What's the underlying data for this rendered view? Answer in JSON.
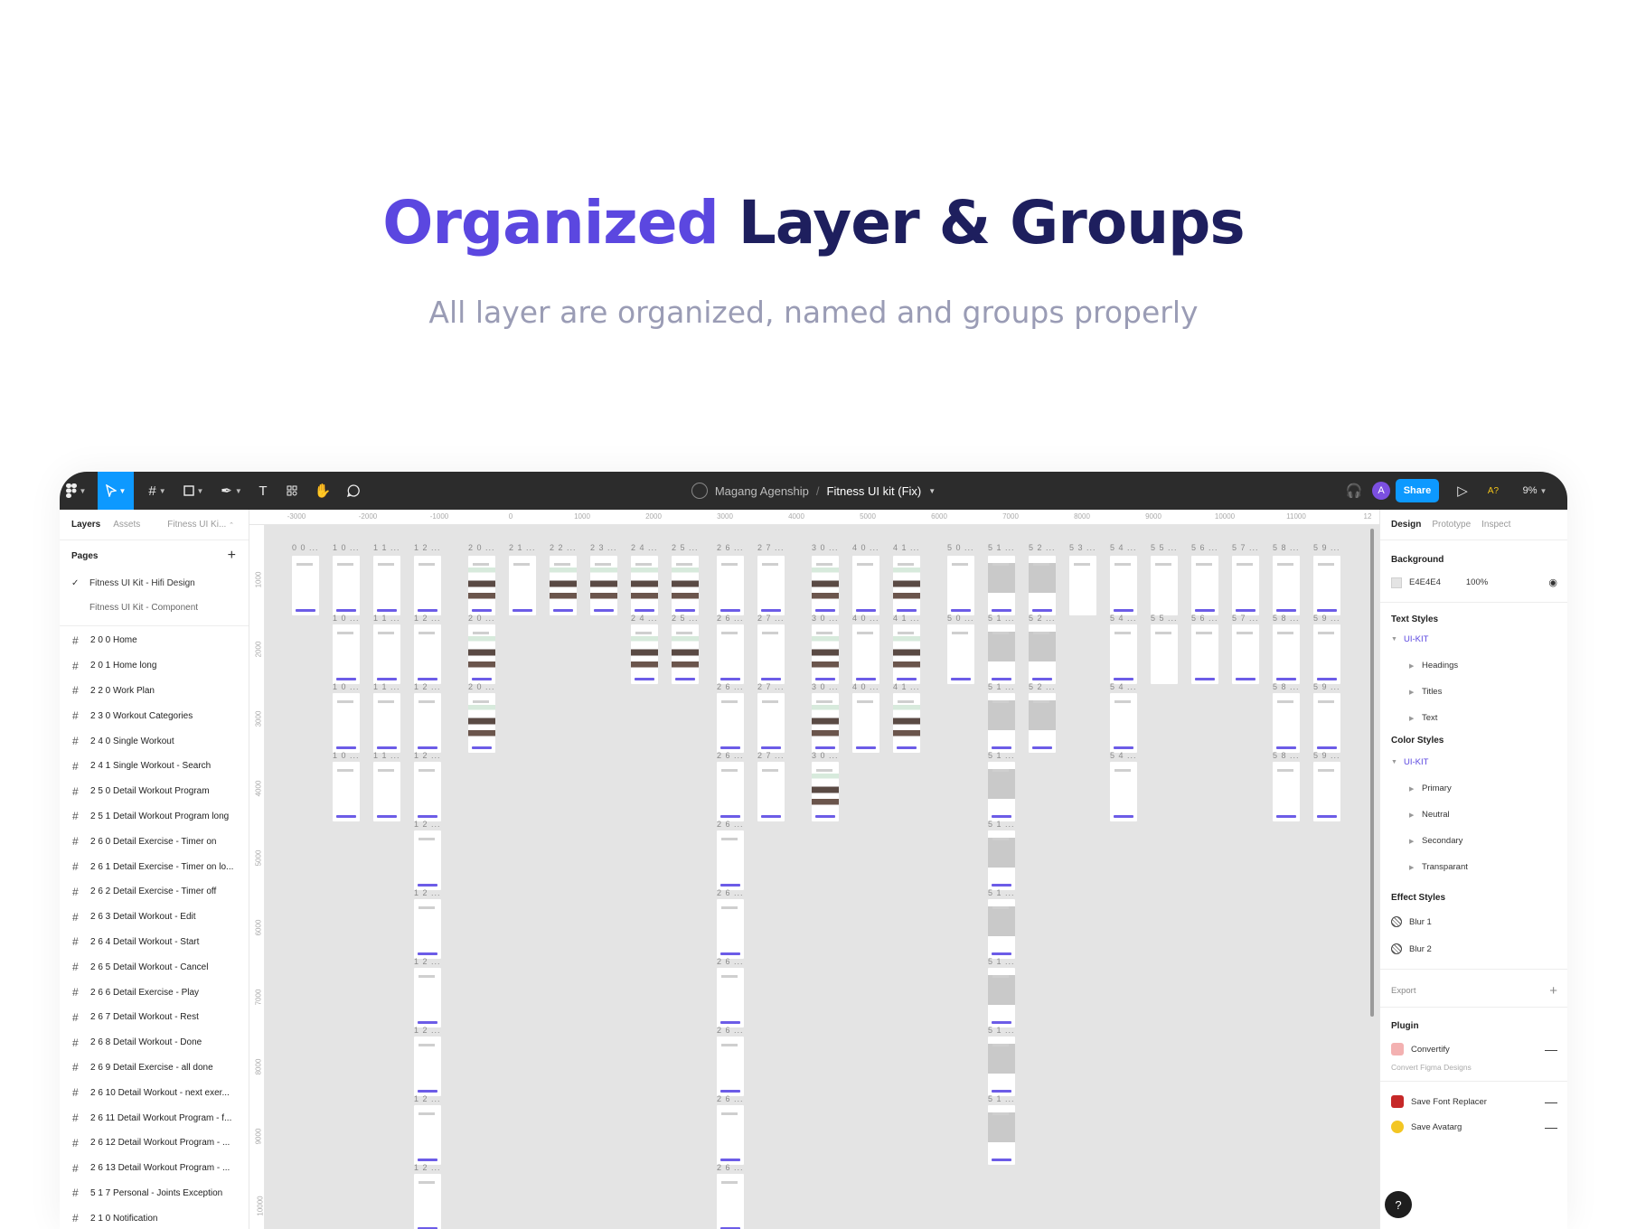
{
  "hero": {
    "title_accent": "Organized",
    "title_rest": "Layer & Groups",
    "subtitle": "All layer are organized, named and groups properly"
  },
  "colors": {
    "accent": "#5b47e0",
    "title": "#1e1f5e",
    "subtitle": "#9a9cb5",
    "toolbar": "#2c2c2c",
    "figma_blue": "#0d99ff",
    "canvas": "#e4e4e4"
  },
  "toolbar": {
    "icons": [
      "figma-menu-icon",
      "move-tool-icon",
      "frame-tool-icon",
      "shape-tool-icon",
      "pen-tool-icon",
      "text-tool-icon",
      "resources-icon",
      "hand-tool-icon",
      "comment-tool-icon"
    ],
    "team": "Magang Agenship",
    "separator": "/",
    "file": "Fitness UI kit (Fix)",
    "avatar_initial": "A",
    "share_label": "Share",
    "a11y_badge": "A?",
    "zoom": "9%"
  },
  "left_panel": {
    "tabs": [
      "Layers",
      "Assets"
    ],
    "page_selector": "Fitness UI Ki...",
    "pages_title": "Pages",
    "pages": [
      {
        "label": "Fitness UI Kit - Hifi Design",
        "checked": true
      },
      {
        "label": "Fitness UI Kit - Component",
        "checked": false
      }
    ],
    "layers": [
      "2 0 0  Home",
      "2 0 1  Home long",
      "2 2 0  Work Plan",
      "2 3 0  Workout Categories",
      "2 4 0 Single Workout",
      "2 4 1 Single Workout - Search",
      " 2 5 0  Detail Workout Program",
      " 2 5 1  Detail Workout Program long",
      "2 6 0  Detail Exercise - Timer on",
      "2 6 1  Detail Exercise - Timer on lo...",
      "2 6 2  Detail Exercise - Timer off",
      "2 6 3  Detail Workout - Edit",
      "2 6 4  Detail Workout - Start",
      "2 6 5  Detail Workout - Cancel",
      "2 6 6  Detail Exercise - Play",
      "2 6 7  Detail Workout - Rest",
      "2 6 8  Detail Workout - Done",
      "2 6 9  Detail Exercise - all done",
      "2 6 10  Detail Workout - next exer...",
      " 2 6 11  Detail Workout Program - f...",
      " 2 6 12  Detail Workout Program - ...",
      " 2 6 13  Detail Workout Program - ...",
      "5 1 7 Personal - Joints Exception",
      "2 1 0 Notification"
    ]
  },
  "rulers": {
    "top": [
      "-3000",
      "-2000",
      "-1000",
      "0",
      "1000",
      "2000",
      "3000",
      "4000",
      "5000",
      "6000",
      "7000",
      "8000",
      "9000",
      "10000",
      "11000",
      "12"
    ],
    "left": [
      "1000",
      "2000",
      "3000",
      "4000",
      "5000",
      "6000",
      "7000",
      "8000",
      "9000",
      "10000"
    ]
  },
  "canvas": {
    "columns": [
      {
        "label": "0 0 ...",
        "frames": 1
      },
      {
        "label": "1 0 ...",
        "frames": 4,
        "sublabel": "1 0 ..."
      },
      {
        "label": "1 1 ...",
        "frames": 4,
        "sublabel": "1 1 ..."
      },
      {
        "label": "1 2 ...",
        "frames": 10,
        "sublabel": "1 2 ..."
      },
      {
        "label": "2 0 ...",
        "frames": 3,
        "sublabel": "2 0 ..."
      },
      {
        "label": "2 1 ...",
        "frames": 1
      },
      {
        "label": "2 2 ...",
        "frames": 1
      },
      {
        "label": "2 3 ...",
        "frames": 1
      },
      {
        "label": "2 4 ...",
        "frames": 2,
        "sublabel": "2 4 ..."
      },
      {
        "label": "2 5 ...",
        "frames": 2,
        "sublabel": "2 5 ..."
      },
      {
        "label": "2 6 ...",
        "frames": 10,
        "sublabel": "2 6 ..."
      },
      {
        "label": "2 7 ...",
        "frames": 4,
        "sublabel": "2 7 ..."
      },
      {
        "label": "3 0 ...",
        "frames": 4,
        "sublabel": "3 0 ..."
      },
      {
        "label": "4 0 ...",
        "frames": 3,
        "sublabel": "4 0 ..."
      },
      {
        "label": "4 1 ...",
        "frames": 3,
        "sublabel": "4 1 ..."
      },
      {
        "label": "5 0 ...",
        "frames": 2,
        "sublabel": "5 0 ..."
      },
      {
        "label": "5 1 ...",
        "frames": 9,
        "sublabel": "5 1 ..."
      },
      {
        "label": "5 2 ...",
        "frames": 3,
        "sublabel": "5 2 ..."
      },
      {
        "label": "5 3 ...",
        "frames": 1
      },
      {
        "label": "5 4 ...",
        "frames": 4,
        "sublabel": "5 4 ..."
      },
      {
        "label": "5 5 ...",
        "frames": 2,
        "sublabel": "5 5 ..."
      },
      {
        "label": "5 6 ...",
        "frames": 2,
        "sublabel": "5 6 ..."
      },
      {
        "label": "5 7 ...",
        "frames": 2,
        "sublabel": "5 7 ..."
      },
      {
        "label": "5 8 ...",
        "frames": 4,
        "sublabel": "5 8 ..."
      },
      {
        "label": "5 9 ...",
        "frames": 4,
        "sublabel": "5 9 ..."
      }
    ]
  },
  "right_panel": {
    "tabs": [
      "Design",
      "Prototype",
      "Inspect"
    ],
    "background": {
      "title": "Background",
      "hex": "E4E4E4",
      "opacity": "100%"
    },
    "text_styles": {
      "title": "Text Styles",
      "group": "UI-KIT",
      "items": [
        "Headings",
        "Titles",
        "Text"
      ]
    },
    "color_styles": {
      "title": "Color Styles",
      "group": "UI-KIT",
      "items": [
        "Primary",
        "Neutral",
        "Secondary",
        "Transparant"
      ]
    },
    "effect_styles": {
      "title": "Effect Styles",
      "items": [
        "Blur 1",
        "Blur 2"
      ]
    },
    "export": {
      "title": "Export"
    },
    "plugin": {
      "title": "Plugin",
      "items": [
        {
          "name": "Convertify",
          "description": "Convert Figma Designs",
          "color": "#e05a5a"
        },
        {
          "name": "Save Font Replacer",
          "color": "#c62828"
        },
        {
          "name": "Save Avatarg",
          "color": "#f3c623"
        }
      ]
    },
    "help": "?"
  }
}
